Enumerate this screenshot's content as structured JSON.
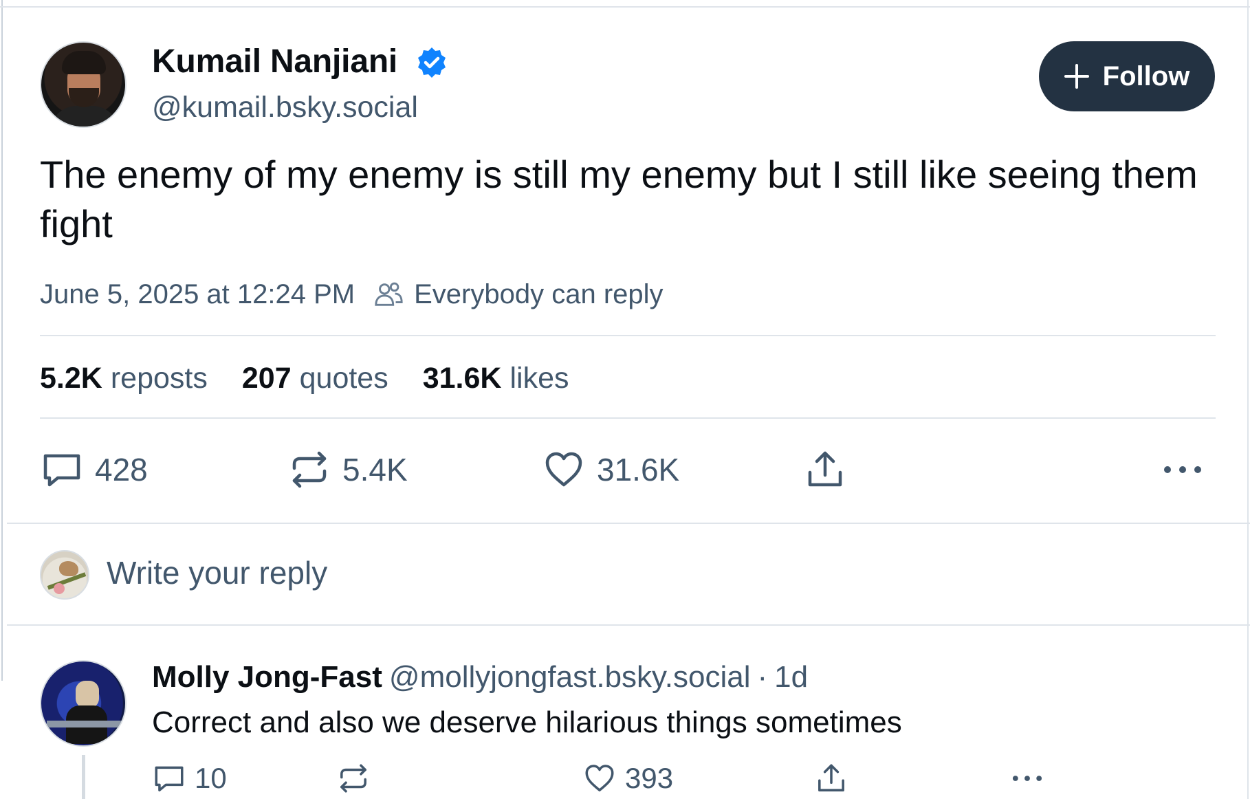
{
  "post": {
    "author": {
      "display_name": "Kumail Nanjiani",
      "handle": "@kumail.bsky.social",
      "verified": true,
      "verified_color": "#1083fe"
    },
    "follow_label": "Follow",
    "text": "The enemy of my enemy is still my enemy but I still like seeing them fight",
    "timestamp": "June 5, 2025 at 12:24 PM",
    "reply_setting": "Everybody can reply",
    "stats": [
      {
        "value": "5.2K",
        "label": "reposts"
      },
      {
        "value": "207",
        "label": "quotes"
      },
      {
        "value": "31.6K",
        "label": "likes"
      }
    ],
    "actions": {
      "reply_count": "428",
      "repost_count": "5.4K",
      "like_count": "31.6K"
    }
  },
  "composer": {
    "placeholder": "Write your reply"
  },
  "reply": {
    "display_name": "Molly Jong-Fast",
    "handle": "@mollyjongfast.bsky.social",
    "separator": "·",
    "age": "1d",
    "text": "Correct and also we deserve hilarious things sometimes",
    "actions": {
      "reply_count": "10",
      "like_count": "393"
    }
  },
  "colors": {
    "follow_button_bg": "#233242",
    "muted_text": "#42576c",
    "divider": "#dfe4ea"
  },
  "icons": [
    "verified-badge-icon",
    "plus-icon",
    "people-icon",
    "reply-icon",
    "repost-icon",
    "like-icon",
    "share-icon",
    "more-icon"
  ]
}
